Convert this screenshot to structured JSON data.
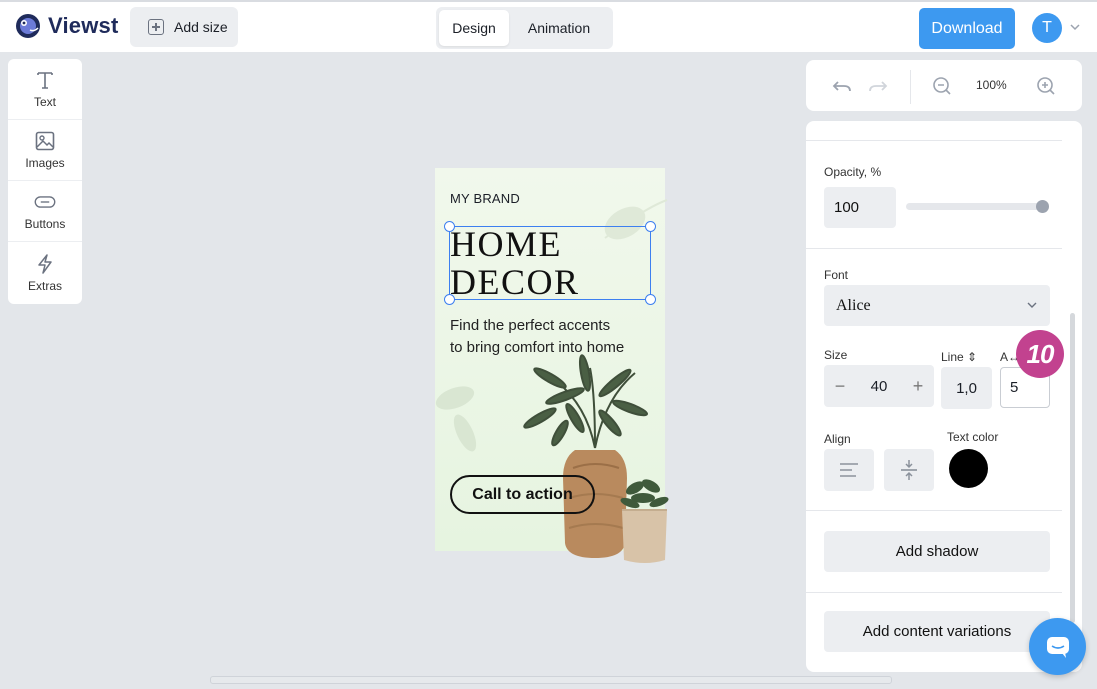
{
  "app": {
    "name": "Viewst"
  },
  "topbar": {
    "add_size_label": "Add size",
    "modes": [
      {
        "label": "Design",
        "active": true
      },
      {
        "label": "Animation",
        "active": false
      }
    ],
    "download_label": "Download",
    "avatar_initial": "T"
  },
  "left_toolbar": {
    "items": [
      {
        "label": "Text",
        "icon": "text-icon"
      },
      {
        "label": "Images",
        "icon": "image-icon"
      },
      {
        "label": "Buttons",
        "icon": "button-icon"
      },
      {
        "label": "Extras",
        "icon": "lightning-icon"
      }
    ]
  },
  "canvas": {
    "brand": "MY BRAND",
    "headline_line1": "HOME",
    "headline_line2": "DECOR",
    "subtext_line1": "Find the perfect accents",
    "subtext_line2": "to bring comfort into home",
    "cta": "Call to action"
  },
  "zoom": {
    "level": "100%"
  },
  "properties": {
    "opacity_label": "Opacity, %",
    "opacity_value": "100",
    "font_label": "Font",
    "font_value": "Alice",
    "size_label": "Size",
    "size_value": "40",
    "line_label": "Line ⇕",
    "line_value": "1,0",
    "letter_spacing_label": "A↔",
    "letter_spacing_value": "5",
    "align_label": "Align",
    "text_color_label": "Text color",
    "text_color": "#000000",
    "add_shadow_label": "Add shadow",
    "add_variations_label": "Add content variations"
  },
  "callout_badge": "10",
  "colors": {
    "accent": "#3d99f0",
    "badge": "#c2428f",
    "selection": "#3d7ff0"
  }
}
